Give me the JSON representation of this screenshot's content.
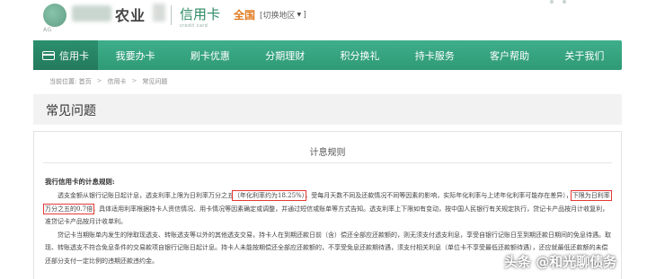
{
  "header": {
    "bank_name": "农业",
    "bank_sub": "AG",
    "product_title": "信用卡",
    "product_sub": "credit card",
    "region_label": "全国",
    "region_switch": "[切换地区",
    "region_switch_end": "]"
  },
  "nav": {
    "items": [
      {
        "label": "信用卡",
        "icon": "card-icon",
        "active": true
      },
      {
        "label": "我要办卡"
      },
      {
        "label": "刷卡优惠"
      },
      {
        "label": "分期理财"
      },
      {
        "label": "积分换礼"
      },
      {
        "label": "持卡服务"
      },
      {
        "label": "客户帮助"
      },
      {
        "label": "关于我们"
      }
    ],
    "accent_color": "#2f9a76",
    "active_color": "#237a5c"
  },
  "breadcrumb": {
    "prefix": "当前位置: 首页",
    "sep": ">",
    "level2": "信用卡",
    "current": "常见问题"
  },
  "section": {
    "title": "常见问题"
  },
  "panel": {
    "title": "计息规则",
    "question": "我行信用卡的计息规则:",
    "para1_a": "透支金额从银行记账日起计息，透支利率上限为日利率万分之五",
    "para1_hl1": "（年化利率约为18.25%）",
    "para1_b": "，受每月天数不同及还款情况不同等因素的影响，实际年化利率与上述年化利率可能存在差异），",
    "para1_hl2": "下限为日利率万分之五的0.7倍",
    "para1_c": "，具体适用利率根据持卡人资信情况、用卡情况等因素确定或调整，并通过短信或账单等方式告知。透支利率上下限如有变动，按中国人民银行有关规定执行，贷记卡产品按月计收复利，准贷记卡产品按月计收单利。",
    "para2": "贷记卡当期账单内发生的除取现透支、转账透支等以外的其他透支交易，持卡人在到期还款日前（含）偿还全部应还款额的，则无须支付透支利息，享受自银行记账日至到期还款日期间的免息待遇。取现、转账透支不符合免息条件的交易款项自银行记账日起计息。持卡人未能按期偿还全部应还款额的，不享受免息还款期待遇，须支付相关利息（单位卡不享受最低还款额待遇），还应就最低还款额的未偿还部分支付一定比例的违期还款违约金。"
  },
  "watermark": "头条 @和光聊债务"
}
